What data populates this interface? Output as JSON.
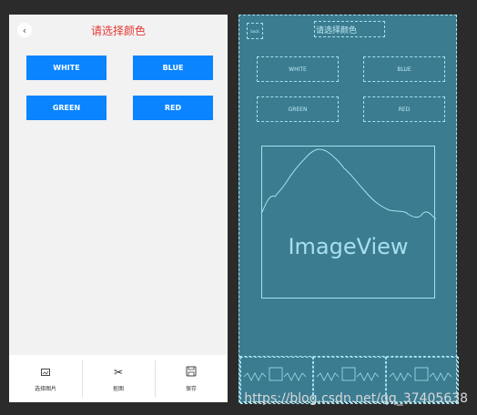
{
  "app": {
    "title": "请选择颜色",
    "back_icon": "chevron-left-icon",
    "colors": {
      "primary_button": "#0a84ff",
      "title": "#e53935",
      "blueprint_bg": "#3b7c90",
      "blueprint_line": "#a5e2f0"
    }
  },
  "buttons": {
    "white": "WHITE",
    "blue": "BLUE",
    "green": "GREEN",
    "red": "RED"
  },
  "bottom_bar": {
    "tabs": [
      {
        "label": "选择图片",
        "icon": "image-icon"
      },
      {
        "label": "抠图",
        "icon": "scissors-icon"
      },
      {
        "label": "保存",
        "icon": "save-icon"
      }
    ]
  },
  "blueprint": {
    "title": "请选择颜色",
    "back_label": "back",
    "white": "WHITE",
    "blue": "BLUE",
    "green": "GREEN",
    "red": "RED",
    "imageview_label": "ImageView"
  },
  "watermark": "https://blog.csdn.net/qq_37405638"
}
